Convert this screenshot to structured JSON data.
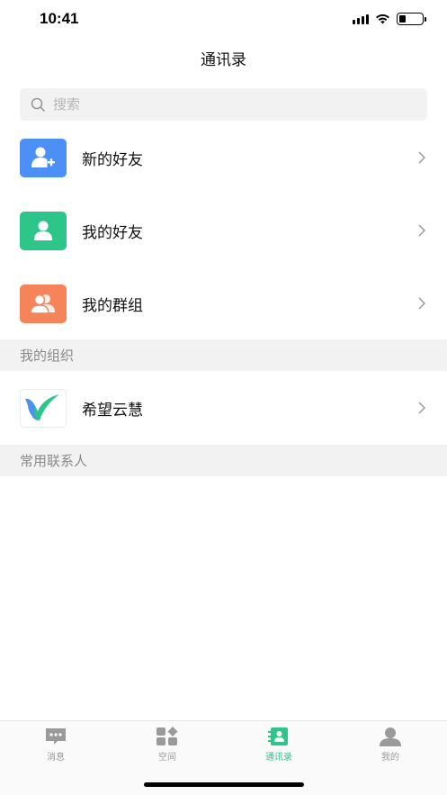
{
  "status_bar": {
    "time": "10:41",
    "battery_fraction": 0.3
  },
  "nav": {
    "title": "通讯录"
  },
  "search": {
    "placeholder": "搜索",
    "value": ""
  },
  "contacts_menu": [
    {
      "label": "新的好友",
      "icon": "add-friend-icon",
      "color": "#4c8ff7"
    },
    {
      "label": "我的好友",
      "icon": "friend-icon",
      "color": "#2ec58b"
    },
    {
      "label": "我的群组",
      "icon": "group-icon",
      "color": "#f6845a"
    }
  ],
  "organizations": {
    "header": "我的组织",
    "items": [
      {
        "label": "希望云慧",
        "icon": "org-logo-icon"
      }
    ]
  },
  "frequent_contacts": {
    "header": "常用联系人"
  },
  "tabbar": {
    "active_color": "#2ec58b",
    "tabs": [
      {
        "label": "消息",
        "icon": "message-icon"
      },
      {
        "label": "空间",
        "icon": "space-icon"
      },
      {
        "label": "通讯录",
        "icon": "contacts-icon",
        "active": true
      },
      {
        "label": "我的",
        "icon": "profile-icon"
      }
    ]
  }
}
